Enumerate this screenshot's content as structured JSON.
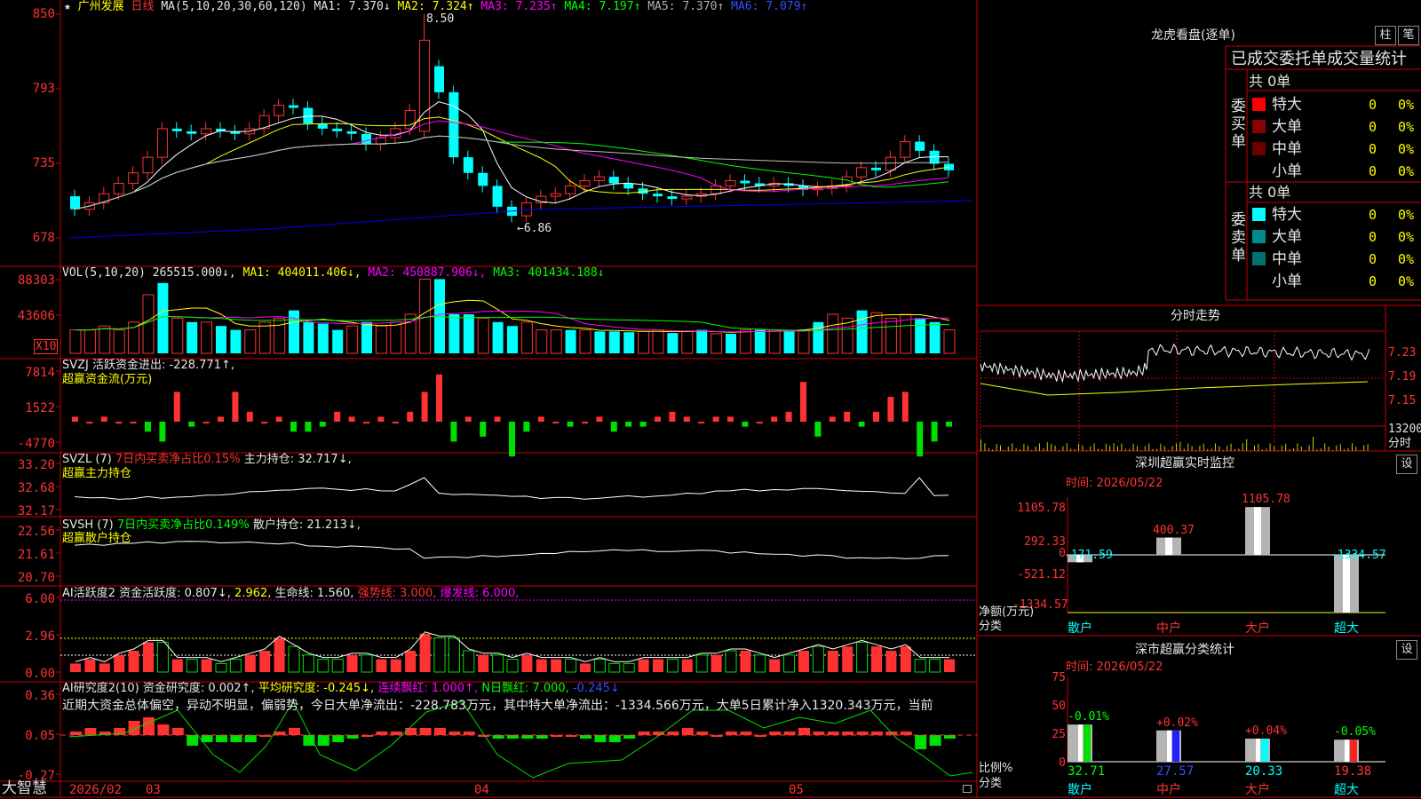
{
  "colors": {
    "up": "#ff3232",
    "down": "#00ffff",
    "grid": "#c8000a",
    "ma1": "#ffffff",
    "ma2": "#ffff00",
    "ma3": "#ff00ff",
    "ma4": "#00ff00",
    "ma5": "#c0c0c0",
    "ma6": "#0000ff"
  },
  "main": {
    "header": {
      "star": "★",
      "stock": "广州发展",
      "period": "日线",
      "ma_def": "MA(5,10,20,30,60,120)",
      "ma1": "MA1: 7.370↓",
      "ma2": "MA2: 7.324↑",
      "ma3": "MA3: 7.235↑",
      "ma4": "MA4: 7.197↑",
      "ma5": "MA5: 7.370↑",
      "ma6": "MA6: 7.079↑"
    },
    "axis": [
      "850",
      "793",
      "735",
      "678"
    ],
    "hi_label": "8.50",
    "lo_label": "←6.86"
  },
  "vol": {
    "header": "VOL(5,10,20)",
    "v": "265515.000↓,",
    "ma1": "MA1: 404011.406↓,",
    "ma2": "MA2: 450887.906↓,",
    "ma3": "MA3: 401434.188↓",
    "axis": [
      "88303",
      "43606"
    ],
    "unit": "X10"
  },
  "svzj": {
    "header": "SVZJ  活跃资金进出: -228.771↑,",
    "sub": "超赢资金流(万元)",
    "axis": [
      "7814",
      "1522",
      "-4770"
    ]
  },
  "svzl": {
    "header_a": "SVZL (7)",
    "header_b": "7日内买卖净占比0.15%",
    "header_c": "主力持仓: 32.717↓,",
    "sub": "超赢主力持仓",
    "axis": [
      "33.20",
      "32.68",
      "32.17"
    ]
  },
  "svsh": {
    "header_a": "SVSH (7)",
    "header_b": "7日内买卖净占比0.149%",
    "header_c": "散户持仓: 21.213↓,",
    "sub": "超赢散户持仓",
    "axis": [
      "22.56",
      "21.61",
      "20.70"
    ]
  },
  "ai1": {
    "h1": "AI活跃度2",
    "h2": "资金活跃度: 0.807↓,",
    "h3": "2.962,",
    "h4": "生命线: 1.560,",
    "h5": "强势线: 3.000,",
    "h6": "爆发线: 6.000,",
    "axis": [
      "6.00",
      "2.96",
      "0.00"
    ]
  },
  "ai2": {
    "h1": "AI研究度2(10)",
    "h2": "资金研究度: 0.002↑,",
    "h3": "平均研究度: -0.245↓,",
    "h4": "连续飘红: 1.000↑,",
    "h5": "N日飘红: 7.000,",
    "h6": "-0.245↓",
    "comment": "近期大资金总体偏空，异动不明显，偏弱势，今日大单净流出：-228.783万元，其中特大单净流出：-1334.566万元，大单5日累计净入1320.343万元，当前",
    "axis": [
      "0.36",
      "0.05",
      "-0.27"
    ]
  },
  "xaxis": {
    "brand": "大智慧",
    "labels": [
      "2026/02",
      "03",
      "04",
      "05"
    ]
  },
  "right": {
    "lhb": {
      "title": "龙虎看盘(逐单)",
      "btn1": "柱",
      "btn2": "笔",
      "heading": "已成交委托单成交量统计",
      "buy": {
        "side": "委买单",
        "total": "共 0单",
        "rows": [
          {
            "n": "特大",
            "v": "0",
            "p": "0%"
          },
          {
            "n": "大单",
            "v": "0",
            "p": "0%"
          },
          {
            "n": "中单",
            "v": "0",
            "p": "0%"
          },
          {
            "n": "小单",
            "v": "0",
            "p": "0%"
          }
        ]
      },
      "sell": {
        "side": "委卖单",
        "total": "共 0单",
        "rows": [
          {
            "n": "特大",
            "v": "0",
            "p": "0%"
          },
          {
            "n": "大单",
            "v": "0",
            "p": "0%"
          },
          {
            "n": "中单",
            "v": "0",
            "p": "0%"
          },
          {
            "n": "小单",
            "v": "0",
            "p": "0%"
          }
        ]
      }
    },
    "fenshi": {
      "title": "分时走势",
      "axis": [
        "7.23",
        "7.19",
        "7.15"
      ],
      "vol": "13200",
      "vlabel": "分时"
    },
    "monitor": {
      "title": "深圳超赢实时监控",
      "btn": "设",
      "time": "时间: 2026/05/22",
      "axis": [
        "1105.78",
        "292.33",
        "0",
        "-521.12",
        "-1334.57"
      ],
      "ylabel1": "净额(万元)",
      "ylabel2": "分类",
      "cats": [
        "散户",
        "中户",
        "大户",
        "超大"
      ],
      "vals": [
        -171.59,
        400.37,
        1105.78,
        -1334.57
      ],
      "labels": [
        "-171.59",
        "400.37",
        "1105.78",
        "-1334.57"
      ]
    },
    "stat": {
      "title": "深市超赢分类统计",
      "btn": "设",
      "time": "时间: 2026/05/22",
      "axis": [
        "75",
        "50",
        "25",
        "0"
      ],
      "ylabel1": "比例%",
      "ylabel2": "分类",
      "cats": [
        "散户",
        "中户",
        "大户",
        "超大"
      ],
      "vals": [
        32.71,
        27.57,
        20.33,
        19.38
      ],
      "labels": [
        "32.71",
        "27.57",
        "20.33",
        "19.38"
      ],
      "deltas": [
        "-0.01%",
        "+0.02%",
        "+0.04%",
        "-0.05%"
      ]
    }
  },
  "chart_data": [
    {
      "type": "candlestick",
      "title": "广州发展 日线",
      "ylim": [
        6.78,
        8.5
      ],
      "high": "8.50",
      "low": "6.86",
      "ma": {
        "MA1": 7.37,
        "MA2": 7.324,
        "MA3": 7.235,
        "MA4": 7.197,
        "MA5": 7.37,
        "MA6": 7.079
      }
    },
    {
      "type": "bar",
      "title": "VOL(5,10,20)",
      "last": 265515.0,
      "MA1": 404011.406,
      "MA2": 450887.906,
      "MA3": 401434.188
    },
    {
      "type": "bar",
      "title": "超赢资金流(万元)",
      "last": -228.771
    },
    {
      "type": "bar",
      "title": "深圳超赢实时监控",
      "categories": [
        "散户",
        "中户",
        "大户",
        "超大"
      ],
      "values": [
        -171.59,
        400.37,
        1105.78,
        -1334.57
      ]
    },
    {
      "type": "bar",
      "title": "深市超赢分类统计",
      "categories": [
        "散户",
        "中户",
        "大户",
        "超大"
      ],
      "values": [
        32.71,
        27.57,
        20.33,
        19.38
      ]
    }
  ]
}
